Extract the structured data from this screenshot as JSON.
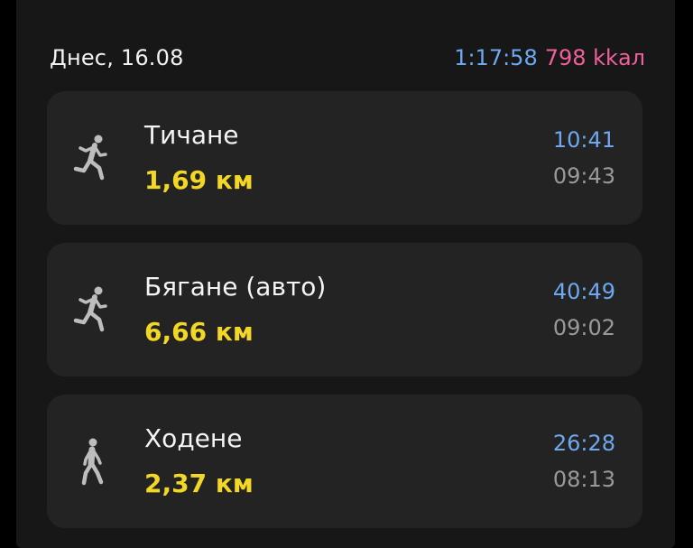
{
  "header": {
    "date": "Днес, 16.08",
    "total_time": "1:17:58",
    "total_calories": "798 kkал"
  },
  "activities": [
    {
      "name": "Тичане",
      "distance": "1,69 км",
      "duration": "10:41",
      "start_time": "09:43",
      "icon": "running-person-icon"
    },
    {
      "name": "Бягане (авто)",
      "distance": "6,66 км",
      "duration": "40:49",
      "start_time": "09:02",
      "icon": "running-person-icon"
    },
    {
      "name": "Ходене",
      "distance": "2,37 км",
      "duration": "26:28",
      "start_time": "08:13",
      "icon": "walking-person-icon"
    }
  ],
  "colors": {
    "background": "#171717",
    "card": "#232323",
    "duration": "#6ea8f0",
    "calories": "#f0609a",
    "distance": "#f2d726",
    "secondary": "#9a9a9a"
  }
}
